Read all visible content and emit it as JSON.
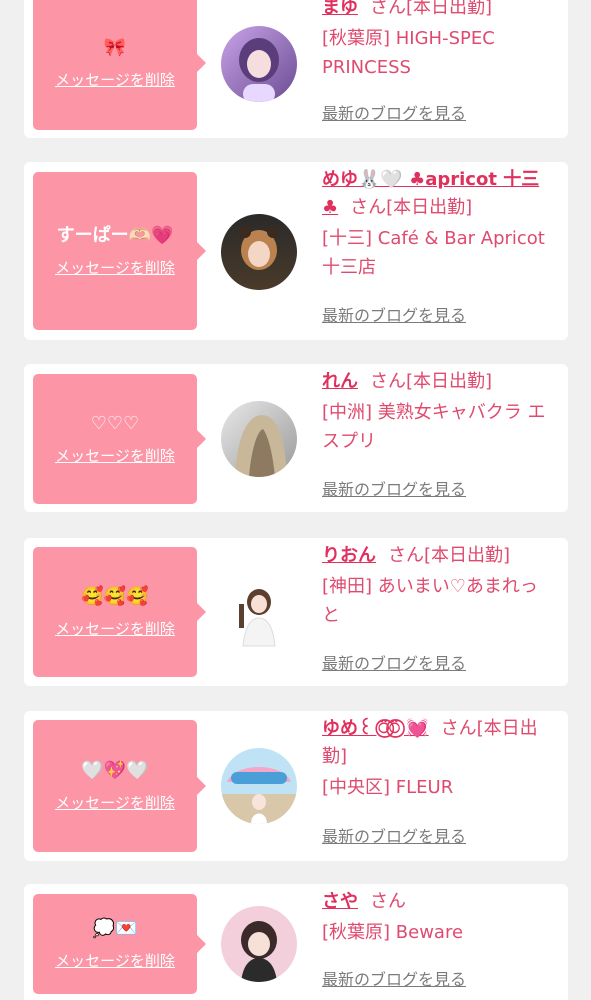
{
  "colors": {
    "background": "#f1f0f0",
    "card": "#ffffff",
    "bubble": "#fc96a7",
    "accent": "#e0305e",
    "link_gray": "#7b7b7b"
  },
  "delete_label": "メッセージを削除",
  "blog_label": "最新のブログを見る",
  "messages": [
    {
      "message": "🎀",
      "name": "まゆ",
      "suffix": "さん[本日出勤]",
      "shop": "[秋葉原] HIGH-SPEC PRINCESS",
      "avatar_icon": "profile-photo"
    },
    {
      "message": "すーぱー🫶🏻💗",
      "name": "めゆ🐰🤍 ♣apricot 十三♣",
      "suffix": "さん[本日出勤]",
      "shop": "[十三] Café & Bar Apricot 十三店",
      "avatar_icon": "profile-photo"
    },
    {
      "message": "♡♡♡",
      "name": "れん",
      "suffix": "さん[本日出勤]",
      "shop": "[中洲] 美熟女キャバクラ エスプリ",
      "avatar_icon": "profile-photo"
    },
    {
      "message": "🥰🥰🥰",
      "name": "りおん",
      "suffix": "さん[本日出勤]",
      "shop": "[神田] あいまい♡あまれっと",
      "avatar_icon": "profile-photo"
    },
    {
      "message": "🤍💖🤍",
      "name": "ゆめ꒰ ⍥⃝⍥⃝ 💓",
      "suffix": "さん[本日出勤]",
      "shop": "[中央区] FLEUR",
      "avatar_icon": "profile-photo"
    },
    {
      "message": "💭💌",
      "name": "さや",
      "suffix": "さん",
      "shop": "[秋葉原] Beware",
      "avatar_icon": "profile-photo"
    }
  ]
}
